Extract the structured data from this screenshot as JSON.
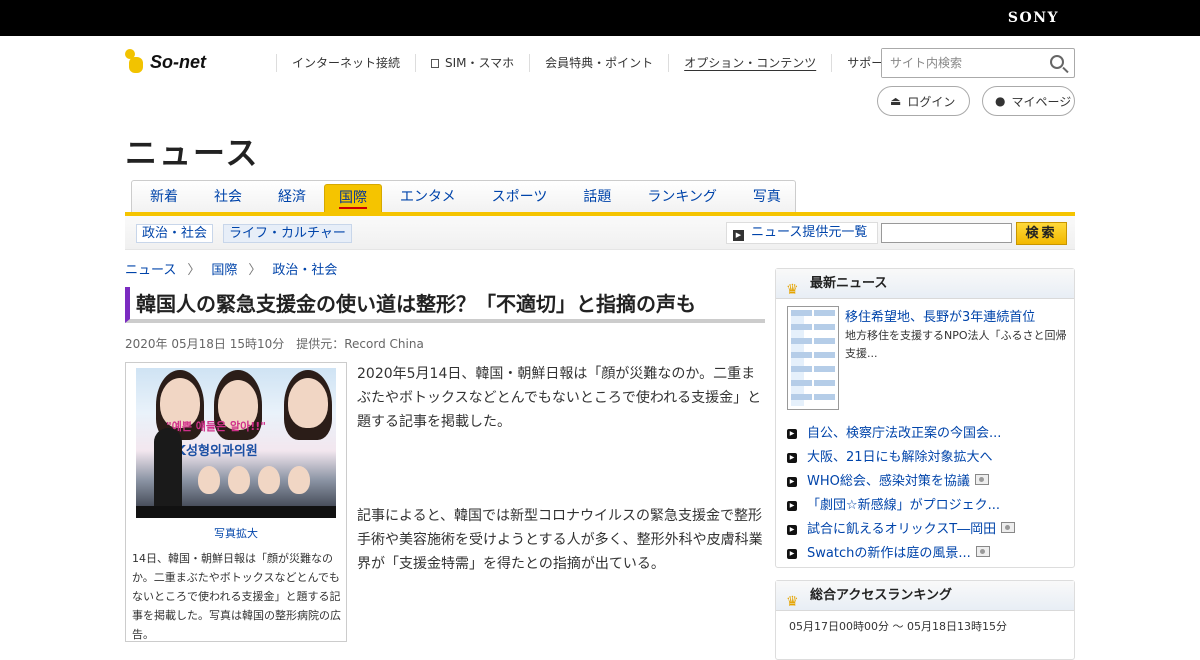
{
  "brand": {
    "sony": "SONY",
    "logo": "So-net"
  },
  "global_nav": [
    {
      "label": "インターネット接続"
    },
    {
      "label": "SIM・スマホ"
    },
    {
      "label": "会員特典・ポイント"
    },
    {
      "label": "オプション・コンテンツ"
    },
    {
      "label": "サポート"
    }
  ],
  "site_search": {
    "placeholder": "サイト内検索"
  },
  "account": {
    "login": "ログイン",
    "mypage": "マイページ"
  },
  "section_title": "ニュース",
  "category_tabs": [
    "新着",
    "社会",
    "経済",
    "国際",
    "エンタメ",
    "スポーツ",
    "話題",
    "ランキング",
    "写真"
  ],
  "active_tab": "国際",
  "subcategories": [
    "政治・社会",
    "ライフ・カルチャー"
  ],
  "providers_link": "ニュース提供元一覧",
  "news_search": {
    "button": "検索"
  },
  "breadcrumb": [
    "ニュース",
    "国際",
    "政治・社会"
  ],
  "article": {
    "headline": "韓国人の緊急支援金の使い道は整形？「不適切」と指摘の声も",
    "date": "2020年 05月18日 15時10分",
    "provider": "提供元：Record China",
    "photo": {
      "banner_text": "\"예쁜 얘들은 알아!!\"",
      "sign_text": "BK성형외과의원",
      "enlarge_label": "写真拡大",
      "caption": "14日、韓国・朝鮮日報は「顔が災難なのか。二重まぶたやボトックスなどとんでもないところで使われる支援金」と題する記事を掲載した。写真は韓国の整形病院の広告。"
    },
    "paragraphs": [
      "2020年5月14日、韓国・朝鮮日報は「顔が災難なのか。二重まぶたやボトックスなどとんでもないところで使われる支援金」と題する記事を掲載した。",
      "記事によると、韓国では新型コロナウイルスの緊急支援金で整形手術や美容施術を受けようとする人が多く、整形外科や皮膚科業界が「支援金特需」を得たとの指摘が出ている。"
    ]
  },
  "latest_news": {
    "title": "最新ニュース",
    "feature_title": "移住希望地、長野が3年連続首位",
    "feature_desc": "地方移住を支援するNPO法人「ふるさと回帰支援...",
    "items": [
      {
        "label": "自公、検察庁法改正案の今国会...",
        "photo": false
      },
      {
        "label": "大阪、21日にも解除対象拡大へ",
        "photo": false
      },
      {
        "label": "WHO総会、感染対策を協議",
        "photo": true
      },
      {
        "label": "「劇団☆新感線」がプロジェク...",
        "photo": false
      },
      {
        "label": "試合に飢えるオリックスT―岡田",
        "photo": true
      },
      {
        "label": "Swatchの新作は庭の風景...",
        "photo": true
      }
    ]
  },
  "ranking": {
    "title": "総合アクセスランキング",
    "period": "05月17日00時00分 ～ 05月18日13時15分"
  },
  "colors": {
    "accent_yellow": "#f5c400",
    "link_blue": "#0044aa",
    "headline_bar": "#7b2bc1"
  }
}
